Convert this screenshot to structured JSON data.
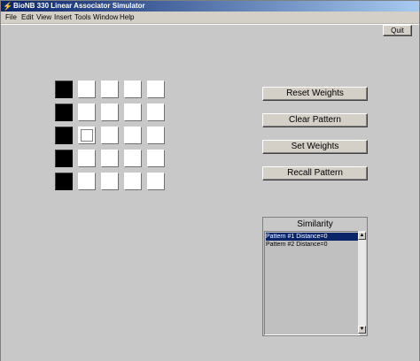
{
  "window": {
    "title": "BioNB 330 Linear Associator Simulator"
  },
  "menu": [
    "File",
    "Edit",
    "View",
    "Insert",
    "Tools",
    "Window",
    "Help"
  ],
  "buttons": {
    "quit": "Quit",
    "reset_weights": "Reset Weights",
    "clear_pattern": "Clear Pattern",
    "set_weights": "Set Weights",
    "recall_pattern": "Recall Pattern"
  },
  "grid": {
    "rows": 5,
    "cols": 5,
    "cells": [
      [
        1,
        0,
        0,
        0,
        0
      ],
      [
        1,
        0,
        0,
        0,
        0
      ],
      [
        1,
        0,
        0,
        0,
        0
      ],
      [
        1,
        0,
        0,
        0,
        0
      ],
      [
        1,
        0,
        0,
        0,
        0
      ]
    ],
    "focused_cell": [
      2,
      1
    ],
    "colors": {
      "on": "#000000",
      "off": "#ffffff"
    }
  },
  "similarity": {
    "title": "Similarity",
    "items": [
      "Pattern #1  Distance=0",
      "Pattern #2  Distance=0"
    ],
    "selected_index": 0,
    "scroll_up": "▲",
    "scroll_down": "▼"
  },
  "colors": {
    "titlebar_start": "#0a246a",
    "titlebar_end": "#a6caf0",
    "background": "#c8c8c8",
    "selection": "#0a246a"
  }
}
